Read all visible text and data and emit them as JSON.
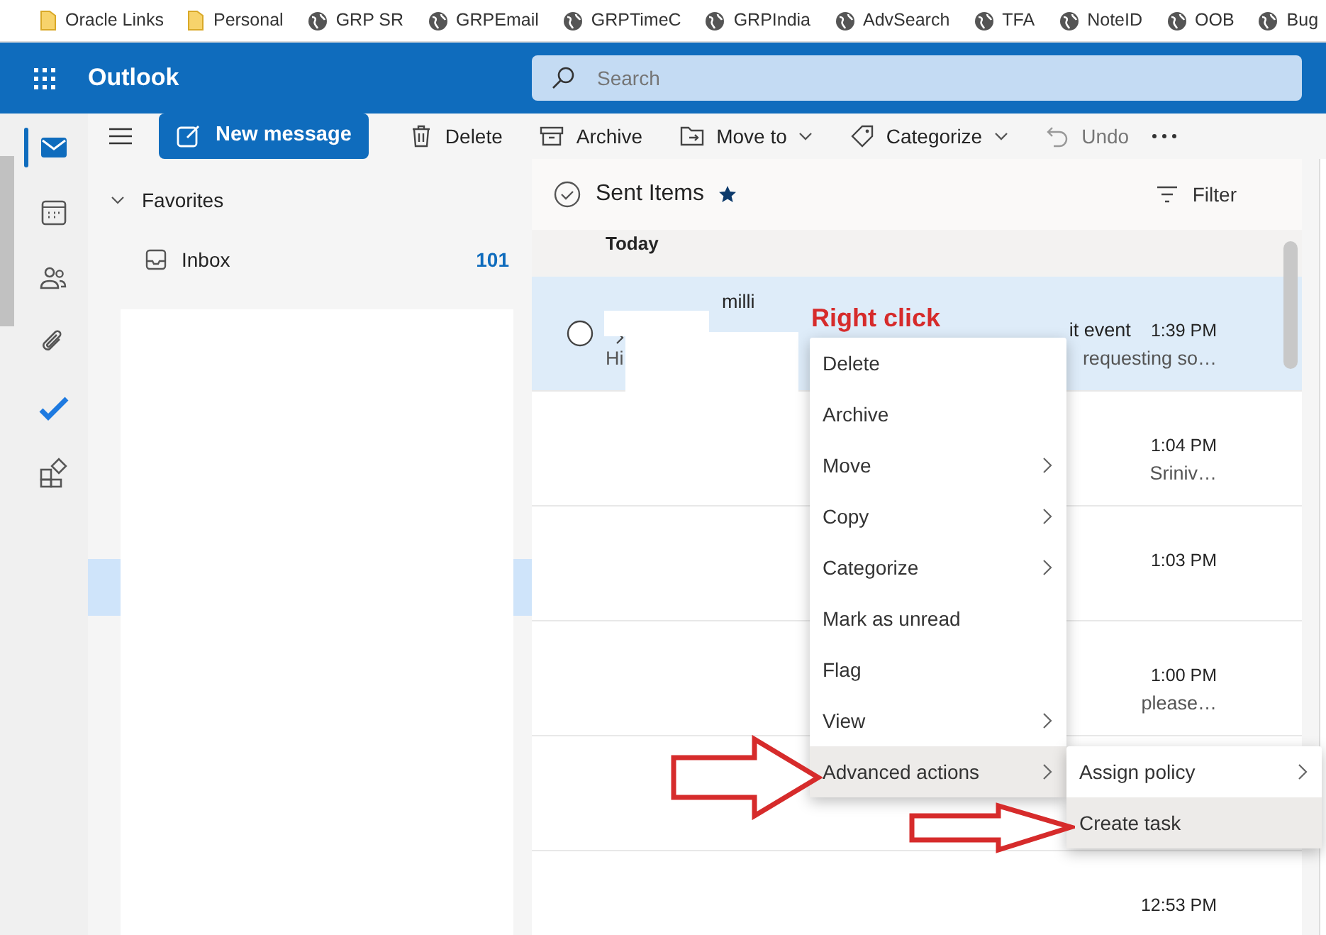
{
  "bookmarks": [
    {
      "kind": "folder",
      "label": "Oracle Links"
    },
    {
      "kind": "folder",
      "label": "Personal"
    },
    {
      "kind": "globe",
      "label": "GRP SR"
    },
    {
      "kind": "globe",
      "label": "GRPEmail"
    },
    {
      "kind": "globe",
      "label": "GRPTimeC"
    },
    {
      "kind": "globe",
      "label": "GRPIndia"
    },
    {
      "kind": "globe",
      "label": "AdvSearch"
    },
    {
      "kind": "globe",
      "label": "TFA"
    },
    {
      "kind": "globe",
      "label": "NoteID"
    },
    {
      "kind": "globe",
      "label": "OOB"
    },
    {
      "kind": "globe",
      "label": "Bug"
    }
  ],
  "app": {
    "name": "Outlook"
  },
  "search": {
    "placeholder": "Search"
  },
  "rail": [
    {
      "kind": "mail",
      "selected": true
    },
    {
      "kind": "calendar",
      "selected": false
    },
    {
      "kind": "people",
      "selected": false
    },
    {
      "kind": "attachment",
      "selected": false
    },
    {
      "kind": "todo",
      "selected": false
    },
    {
      "kind": "apps",
      "selected": false
    }
  ],
  "toolbar": {
    "new_message": "New message",
    "actions": [
      {
        "kind": "trash",
        "label": "Delete",
        "dropdown": false,
        "disabled": false
      },
      {
        "kind": "archive",
        "label": "Archive",
        "dropdown": false,
        "disabled": false
      },
      {
        "kind": "move",
        "label": "Move to",
        "dropdown": true,
        "disabled": false
      },
      {
        "kind": "tag",
        "label": "Categorize",
        "dropdown": true,
        "disabled": false
      },
      {
        "kind": "undo",
        "label": "Undo",
        "dropdown": false,
        "disabled": true
      }
    ]
  },
  "folders": {
    "section": "Favorites",
    "expanded": true,
    "items": [
      {
        "label": "Inbox",
        "count": "101",
        "selected": false
      }
    ]
  },
  "message_list": {
    "title": "Sent Items",
    "favorite": true,
    "filter": "Filter",
    "group": "Today",
    "rows": [
      {
        "selected": true,
        "sender": "milli",
        "subject": "it event",
        "time": "1:39 PM",
        "preview_start": "Hi",
        "preview": "requesting so…"
      },
      {
        "selected": false,
        "time": "1:04 PM",
        "preview": "Sriniv…"
      },
      {
        "selected": false,
        "time": "1:03 PM"
      },
      {
        "selected": false,
        "time": "1:00 PM",
        "preview": "please…"
      },
      {
        "selected": false
      },
      {
        "selected": false,
        "time": "12:53 PM"
      }
    ]
  },
  "context_menu": {
    "items": [
      {
        "label": "Delete",
        "submenu": false,
        "highlighted": false
      },
      {
        "label": "Archive",
        "submenu": false,
        "highlighted": false
      },
      {
        "label": "Move",
        "submenu": true,
        "highlighted": false
      },
      {
        "label": "Copy",
        "submenu": true,
        "highlighted": false
      },
      {
        "label": "Categorize",
        "submenu": true,
        "highlighted": false
      },
      {
        "label": "Mark as unread",
        "submenu": false,
        "highlighted": false
      },
      {
        "label": "Flag",
        "submenu": false,
        "highlighted": false
      },
      {
        "label": "View",
        "submenu": true,
        "highlighted": false
      },
      {
        "label": "Advanced actions",
        "submenu": true,
        "highlighted": true
      }
    ]
  },
  "submenu": {
    "items": [
      {
        "label": "Assign policy",
        "submenu": true,
        "highlighted": false
      },
      {
        "label": "Create task",
        "submenu": false,
        "highlighted": true
      }
    ]
  },
  "annotation": {
    "text": "Right click"
  }
}
